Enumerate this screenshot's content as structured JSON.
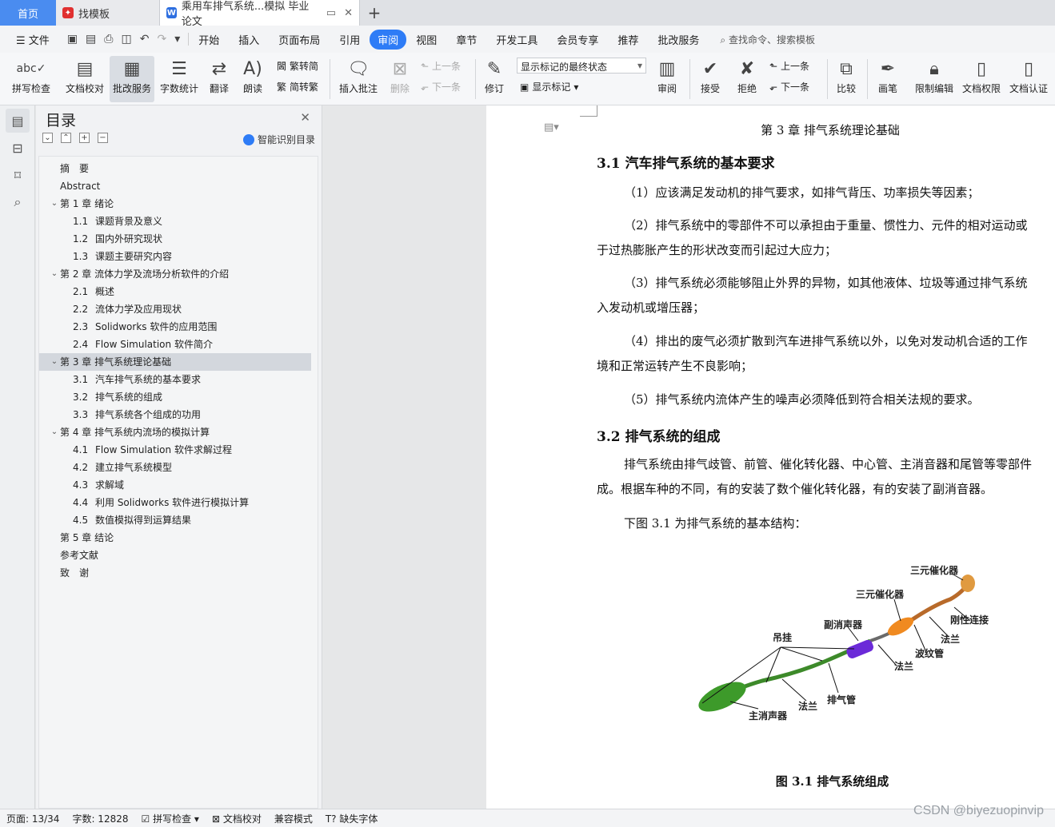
{
  "tabs": {
    "home": "首页",
    "template": "找模板",
    "doc": "乘用车排气系统...模拟 毕业论文"
  },
  "menu": {
    "file": "文件",
    "items": [
      "开始",
      "插入",
      "页面布局",
      "引用",
      "审阅",
      "视图",
      "章节",
      "开发工具",
      "会员专享",
      "推荐",
      "批改服务"
    ],
    "active": "审阅",
    "search": "查找命令、搜索模板"
  },
  "ribbon": {
    "spell": "拼写检查",
    "proof": "文档校对",
    "correct": "批改服务",
    "count": "字数统计",
    "translate": "翻译",
    "read": "朗读",
    "trad": "繁转简",
    "simp": "简转繁",
    "insert_comment": "插入批注",
    "delete": "删除",
    "prev": "上一条",
    "next": "下一条",
    "revise": "修订",
    "markup_state": "显示标记的最终状态",
    "show_markup": "显示标记",
    "review": "审阅",
    "accept": "接受",
    "reject": "拒绝",
    "prev2": "上一条",
    "next2": "下一条",
    "compare": "比较",
    "pen": "画笔",
    "restrict": "限制编辑",
    "perm": "文档权限",
    "cert": "文档认证"
  },
  "toc": {
    "title": "目录",
    "smart": "智能识别目录",
    "items": [
      {
        "level": 1,
        "caret": false,
        "num": "",
        "text": "摘　要"
      },
      {
        "level": 1,
        "caret": false,
        "num": "",
        "text": "Abstract"
      },
      {
        "level": 1,
        "caret": true,
        "num": "",
        "text": "第 1 章  绪论"
      },
      {
        "level": 2,
        "num": "1.1",
        "text": "课题背景及意义"
      },
      {
        "level": 2,
        "num": "1.2",
        "text": "国内外研究现状"
      },
      {
        "level": 2,
        "num": "1.3",
        "text": "课题主要研究内容"
      },
      {
        "level": 1,
        "caret": true,
        "num": "",
        "text": "第 2 章  流体力学及流场分析软件的介绍"
      },
      {
        "level": 2,
        "num": "2.1",
        "text": "概述"
      },
      {
        "level": 2,
        "num": "2.2",
        "text": "流体力学及应用现状"
      },
      {
        "level": 2,
        "num": "2.3",
        "text": "Solidworks 软件的应用范围"
      },
      {
        "level": 2,
        "num": "2.4",
        "text": "Flow Simulation  软件简介"
      },
      {
        "level": 1,
        "caret": true,
        "num": "",
        "text": "第 3 章  排气系统理论基础",
        "selected": true
      },
      {
        "level": 2,
        "num": "3.1",
        "text": "汽车排气系统的基本要求"
      },
      {
        "level": 2,
        "num": "3.2",
        "text": "排气系统的组成"
      },
      {
        "level": 2,
        "num": "3.3",
        "text": "排气系统各个组成的功用"
      },
      {
        "level": 1,
        "caret": true,
        "num": "",
        "text": "第 4 章  排气系统内流场的模拟计算"
      },
      {
        "level": 2,
        "num": "4.1",
        "text": "Flow Simulation 软件求解过程"
      },
      {
        "level": 2,
        "num": "4.2",
        "text": "建立排气系统模型"
      },
      {
        "level": 2,
        "num": "4.3",
        "text": "求解域"
      },
      {
        "level": 2,
        "num": "4.4",
        "text": "利用 Solidworks 软件进行模拟计算"
      },
      {
        "level": 2,
        "num": "4.5",
        "text": "数值模拟得到运算结果"
      },
      {
        "level": 1,
        "caret": false,
        "num": "",
        "text": "第 5 章  结论"
      },
      {
        "level": 1,
        "caret": false,
        "num": "",
        "text": "参考文献"
      },
      {
        "level": 1,
        "caret": false,
        "num": "",
        "text": "致　谢"
      }
    ]
  },
  "doc": {
    "chapter": "第 3 章  排气系统理论基础",
    "h31": "3.1    汽车排气系统的基本要求",
    "p1": "（1）应该满足发动机的排气要求，如排气背压、功率损失等因素；",
    "p2a": "（2）排气系统中的零部件不可以承担由于重量、惯性力、元件的相对运动或",
    "p2b": "于过热膨胀产生的形状改变而引起过大应力；",
    "p3a": "（3）排气系统必须能够阻止外界的异物，如其他液体、垃圾等通过排气系统",
    "p3b": "入发动机或增压器；",
    "p4a": "（4）排出的废气必须扩散到汽车进排气系统以外，以免对发动机合适的工作",
    "p4b": "境和正常运转产生不良影响；",
    "p5": "（5）排气系统内流体产生的噪声必须降低到符合相关法规的要求。",
    "h32": "3.2    排气系统的组成",
    "p6a": "排气系统由排气歧管、前管、催化转化器、中心管、主消音器和尾管等零部件",
    "p6b": "成。根据车种的不同，有的安装了数个催化转化器，有的安装了副消音器。",
    "p7": "下图 3.1 为排气系统的基本结构：",
    "fig_labels": {
      "cat1": "三元催化器",
      "cat2": "三元催化器",
      "rigid": "刚性连接",
      "sub": "副消声器",
      "hang": "吊挂",
      "flange1": "法兰",
      "bellows": "波纹管",
      "flange2": "法兰",
      "pipe": "排气管",
      "flange3": "法兰",
      "main": "主消声器"
    },
    "caption": "图 3.1 排气系统组成"
  },
  "status": {
    "page": "页面: 13/34",
    "words": "字数: 12828",
    "spell": "拼写检查",
    "proof": "文档校对",
    "compat": "兼容模式",
    "font": "缺失字体"
  },
  "watermark": "CSDN @biyezuopinvip"
}
